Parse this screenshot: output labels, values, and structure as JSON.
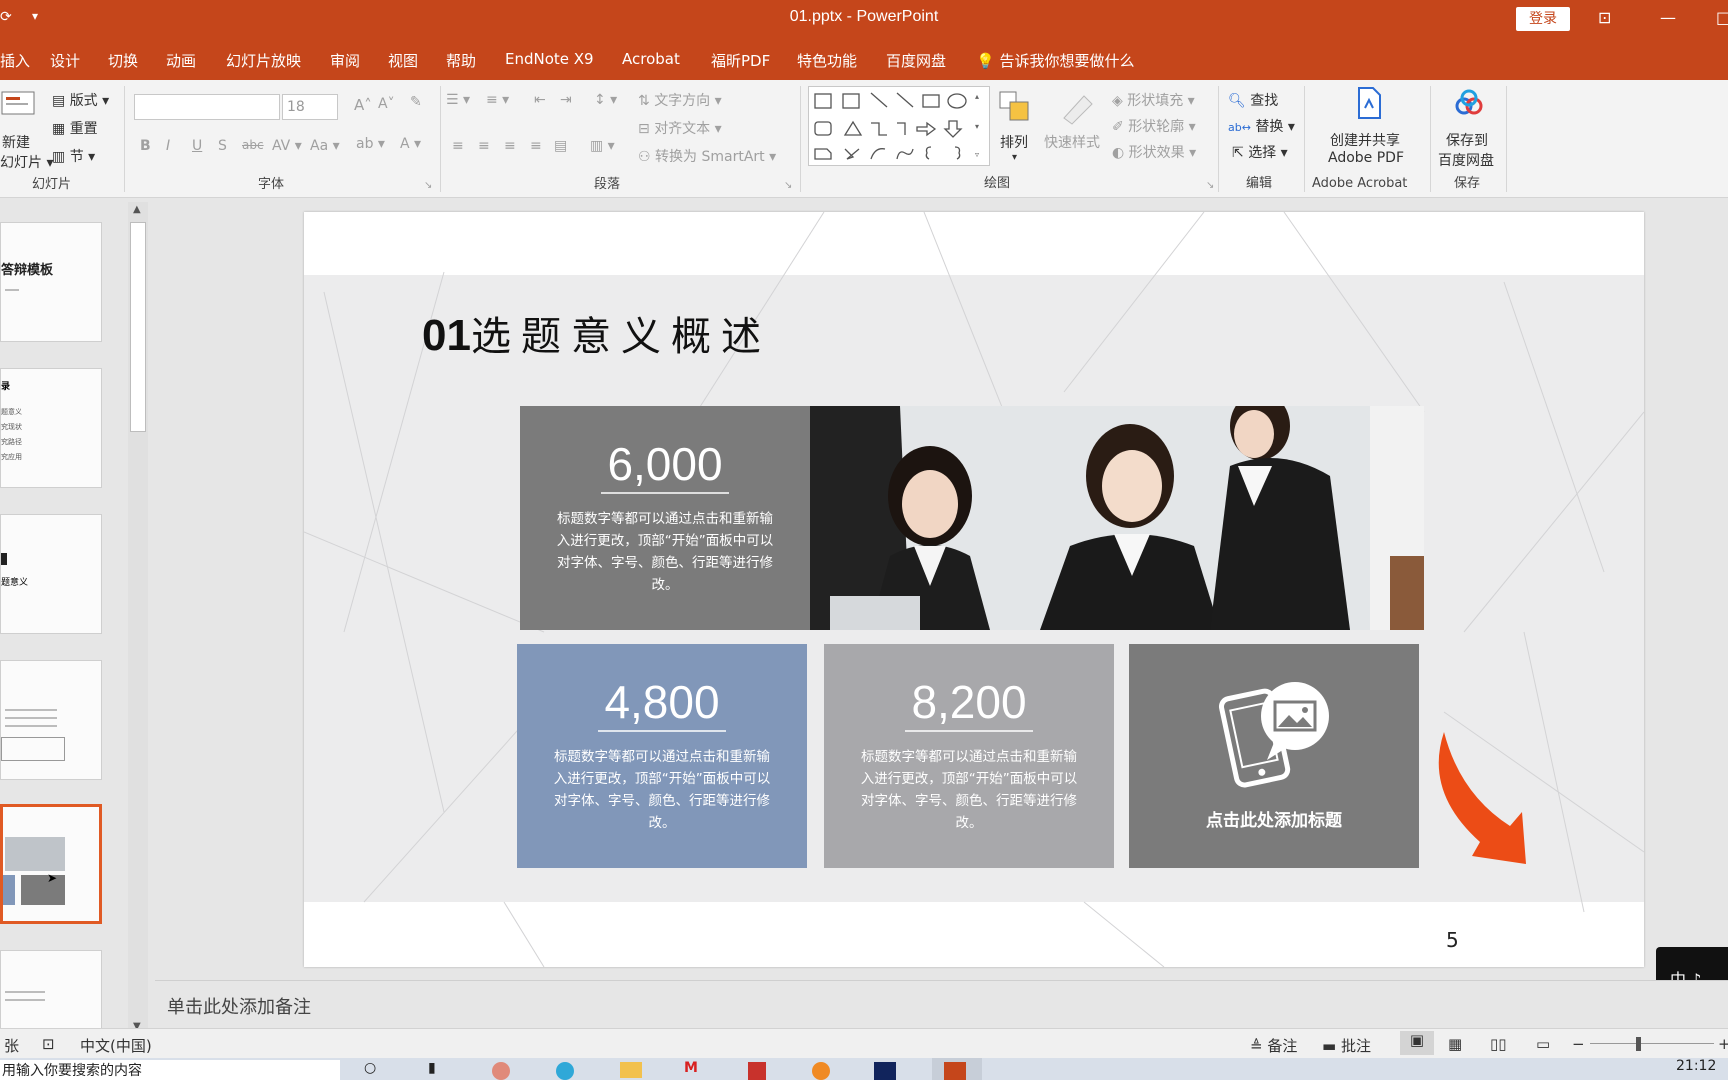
{
  "titlebar": {
    "title": "01.pptx  -  PowerPoint",
    "login": "登录"
  },
  "menu": [
    "插入",
    "设计",
    "切换",
    "动画",
    "幻灯片放映",
    "审阅",
    "视图",
    "帮助",
    "EndNote X9",
    "Acrobat",
    "福昕PDF",
    "特色功能",
    "百度网盘"
  ],
  "tell_me": "告诉我你想要做什么",
  "ribbon": {
    "slides": {
      "label": "幻灯片",
      "new_slide_1": "新建",
      "new_slide_2": "幻灯片",
      "layout": "版式",
      "reset": "重置",
      "section": "节"
    },
    "font": {
      "label": "字体",
      "font_name": "",
      "font_size": "18"
    },
    "paragraph": {
      "label": "段落",
      "text_direction": "文字方向",
      "align_text": "对齐文本",
      "smartart": "转换为 SmartArt"
    },
    "drawing": {
      "label": "绘图",
      "arrange": "排列",
      "quick_styles": "快速样式",
      "shape_fill": "形状填充",
      "shape_outline": "形状轮廓",
      "shape_effects": "形状效果"
    },
    "editing": {
      "label": "编辑",
      "find": "查找",
      "replace": "替换",
      "select": "选择"
    },
    "acrobat": {
      "label": "Adobe Acrobat",
      "create_1": "创建并共享",
      "create_2": "Adobe PDF"
    },
    "save": {
      "label": "保存",
      "save_1": "保存到",
      "save_2": "百度网盘"
    }
  },
  "thumbnails": {
    "t1": "答辩模板",
    "t2": "录",
    "t2_items": [
      "题意义",
      "究现状",
      "究路径",
      "究应用"
    ],
    "t3": "题意义"
  },
  "slide": {
    "title_num": "01",
    "title_text": "选题意义概述",
    "card1": {
      "value": "6,000",
      "desc": "标题数字等都可以通过点击和重新输入进行更改，顶部“开始”面板中可以对字体、字号、颜色、行距等进行修改。"
    },
    "card2": {
      "value": "4,800",
      "desc": "标题数字等都可以通过点击和重新输入进行更改，顶部“开始”面板中可以对字体、字号、颜色、行距等进行修改。"
    },
    "card3": {
      "value": "8,200",
      "desc": "标题数字等都可以通过点击和重新输入进行更改，顶部“开始”面板中可以对字体、字号、颜色、行距等进行修改。"
    },
    "card4": {
      "label": "点击此处添加标题"
    },
    "page_number": "5"
  },
  "notes_placeholder": "单击此处添加备注",
  "status": {
    "slide_count": "张",
    "language": "中文(中国)",
    "notes": "备注",
    "comments": "批注"
  },
  "taskbar": {
    "search_text": "用输入你要搜索的内容",
    "clock": "21:12"
  },
  "ime": "中 ♪ ",
  "colors": {
    "accent": "#c5461b",
    "card_dark": "#7b7b7b",
    "card_blue": "#8197b9",
    "card_light": "#a8a8ab",
    "arrow": "#ec4c16"
  }
}
